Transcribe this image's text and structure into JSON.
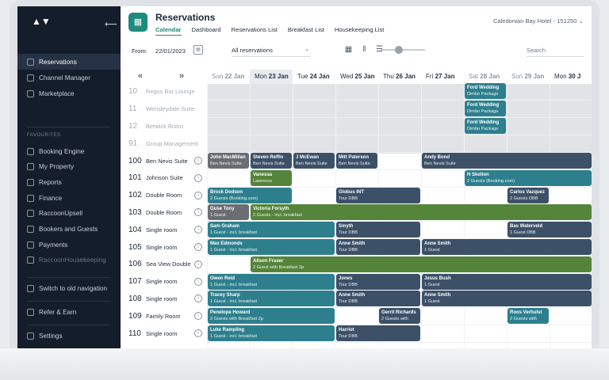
{
  "app": {
    "title": "Reservations",
    "hotel": "Caledonian Bay Hotel - 151250"
  },
  "tabs": [
    "Calendar",
    "Dashboard",
    "Reservations List",
    "Breakfast List",
    "Housekeeping List"
  ],
  "toolbar": {
    "from_label": "From:",
    "from_date": "22/01/2023",
    "filter": "All reservations",
    "search_placeholder": "Search"
  },
  "sidebar": {
    "items": [
      {
        "label": "Reservations",
        "active": true
      },
      {
        "label": "Channel Manager"
      },
      {
        "label": "Marketplace"
      }
    ],
    "favourites_label": "FAVOURITES",
    "favourites": [
      {
        "label": "Booking Engine"
      },
      {
        "label": "My Property"
      },
      {
        "label": "Reports"
      },
      {
        "label": "Finance"
      },
      {
        "label": "RaccoonUpsell"
      },
      {
        "label": "Bookers and Guests"
      },
      {
        "label": "Payments"
      },
      {
        "label": "RaccoonHousekeeping",
        "faded": true
      }
    ],
    "switch": "Switch to old navigation",
    "refer": "Refer & Earn",
    "settings": "Settings"
  },
  "dates": [
    {
      "day": "Sun",
      "num": "22 Jan",
      "weekend": true
    },
    {
      "day": "Mon",
      "num": "23 Jan",
      "today": true
    },
    {
      "day": "Tue",
      "num": "24 Jan"
    },
    {
      "day": "Wed",
      "num": "25 Jan"
    },
    {
      "day": "Thu",
      "num": "26 Jan"
    },
    {
      "day": "Fri",
      "num": "27 Jan"
    },
    {
      "day": "Sat",
      "num": "28 Jan",
      "weekend": true
    },
    {
      "day": "Sun",
      "num": "29 Jan",
      "weekend": true
    },
    {
      "day": "Mon",
      "num": "30 J"
    }
  ],
  "rooms": [
    {
      "num": "10",
      "name": "Regus Bar Lounge",
      "dim": true
    },
    {
      "num": "11",
      "name": "Wensleydale Suite",
      "dim": true
    },
    {
      "num": "12",
      "name": "Berwick Bistro",
      "dim": true
    },
    {
      "num": "91",
      "name": "Group Management",
      "dim": true
    },
    {
      "num": "100",
      "name": "Ben Nevis Suite"
    },
    {
      "num": "101",
      "name": "Johnson Suite"
    },
    {
      "num": "102",
      "name": "Double Room"
    },
    {
      "num": "103",
      "name": "Double Room"
    },
    {
      "num": "104",
      "name": "Single room"
    },
    {
      "num": "105",
      "name": "Single room"
    },
    {
      "num": "106",
      "name": "Sea View Double"
    },
    {
      "num": "107",
      "name": "Single room"
    },
    {
      "num": "108",
      "name": "Single room"
    },
    {
      "num": "109",
      "name": "Family Room"
    },
    {
      "num": "110",
      "name": "Single room"
    }
  ],
  "colors": {
    "teal": "#2e7f8e",
    "slate": "#3c5068",
    "green": "#55843b",
    "grey": "#6a6e73"
  },
  "bookings": [
    {
      "row": 0,
      "start": 6,
      "span": 1,
      "name": "Ford Wedding",
      "detail": "Dimbo Package",
      "color": "teal"
    },
    {
      "row": 1,
      "start": 6,
      "span": 1,
      "name": "Ford Wedding",
      "detail": "Dimbo Package",
      "color": "teal"
    },
    {
      "row": 2,
      "start": 6,
      "span": 1,
      "name": "Ford Wedding",
      "detail": "Dimbo Package",
      "color": "teal"
    },
    {
      "row": 4,
      "start": 0,
      "span": 1,
      "name": "John MacMillan",
      "detail": "Ben Nevis Suite",
      "color": "grey"
    },
    {
      "row": 4,
      "start": 1,
      "span": 1,
      "name": "Steven Reffin",
      "detail": "Ben Nevis Suite",
      "color": "slate"
    },
    {
      "row": 4,
      "start": 2,
      "span": 1,
      "name": "J McEwan",
      "detail": "Ben Nevis Suite",
      "color": "slate"
    },
    {
      "row": 4,
      "start": 3,
      "span": 1,
      "name": "Mitt Paterson",
      "detail": "Ben Nevis Suite",
      "color": "slate"
    },
    {
      "row": 4,
      "start": 5,
      "span": 4,
      "name": "Andy Bond",
      "detail": "Ben Nevis Suite",
      "color": "slate"
    },
    {
      "row": 5,
      "start": 1,
      "span": 1,
      "name": "Vanessa",
      "detail": "Lawrence",
      "color": "green"
    },
    {
      "row": 5,
      "start": 6,
      "span": 3,
      "name": "H Skelton",
      "detail": "2 Guests (Booking.com)",
      "color": "teal"
    },
    {
      "row": 6,
      "start": 0,
      "span": 2,
      "name": "Brock Dodson",
      "detail": "2 Guests (Booking.com)",
      "color": "teal"
    },
    {
      "row": 6,
      "start": 3,
      "span": 2,
      "name": "Globus INT",
      "detail": "Tour DBB",
      "color": "slate"
    },
    {
      "row": 6,
      "start": 7,
      "span": 1,
      "name": "Carlos Vazquez",
      "detail": "2 Guests DBB",
      "color": "slate"
    },
    {
      "row": 7,
      "start": 0,
      "span": 1,
      "name": "Guse Tony",
      "detail": "1 Guest",
      "color": "grey"
    },
    {
      "row": 7,
      "start": 1,
      "span": 8,
      "name": "Victoria Forsyth",
      "detail": "2 Guests - incl. breakfast",
      "color": "green"
    },
    {
      "row": 8,
      "start": 0,
      "span": 3,
      "name": "Sam Graham",
      "detail": "1 Guest - incl. breakfast",
      "color": "teal"
    },
    {
      "row": 8,
      "start": 3,
      "span": 2,
      "name": "Smyth",
      "detail": "Tour DBB",
      "color": "slate"
    },
    {
      "row": 8,
      "start": 7,
      "span": 2,
      "name": "Bas Waterveld",
      "detail": "1 Guest DBB",
      "color": "slate"
    },
    {
      "row": 9,
      "start": 0,
      "span": 3,
      "name": "Max Edmonds",
      "detail": "1 Guest - incl. breakfast",
      "color": "teal"
    },
    {
      "row": 9,
      "start": 3,
      "span": 2,
      "name": "Anne Smith",
      "detail": "Tour DBB",
      "color": "slate"
    },
    {
      "row": 9,
      "start": 5,
      "span": 4,
      "name": "Anne Smith",
      "detail": "1 Guest",
      "color": "slate"
    },
    {
      "row": 10,
      "start": 1,
      "span": 8,
      "name": "Alison Fraser",
      "detail": "2 Guest with Breakfast 2p",
      "color": "green"
    },
    {
      "row": 11,
      "start": 0,
      "span": 3,
      "name": "Owen Reid",
      "detail": "1 Guest - incl. breakfast",
      "color": "teal"
    },
    {
      "row": 11,
      "start": 3,
      "span": 2,
      "name": "Jones",
      "detail": "Tour DBB",
      "color": "slate"
    },
    {
      "row": 11,
      "start": 5,
      "span": 4,
      "name": "Jesus Bush",
      "detail": "1 Guest",
      "color": "slate"
    },
    {
      "row": 12,
      "start": 0,
      "span": 3,
      "name": "Tracey Sharp",
      "detail": "1 Guest - incl. breakfast",
      "color": "teal"
    },
    {
      "row": 12,
      "start": 3,
      "span": 2,
      "name": "Anne Smith",
      "detail": "Tour DBB",
      "color": "slate"
    },
    {
      "row": 12,
      "start": 5,
      "span": 4,
      "name": "Anne Smith",
      "detail": "1 Guest",
      "color": "slate"
    },
    {
      "row": 13,
      "start": 0,
      "span": 3,
      "name": "Penelope Howard",
      "detail": "2 Guests with Breakfast 2p",
      "color": "teal"
    },
    {
      "row": 13,
      "start": 4,
      "span": 1,
      "name": "Gerrit Richards",
      "detail": "2 Guests with",
      "color": "slate"
    },
    {
      "row": 13,
      "start": 7,
      "span": 1,
      "name": "Roos Verhulst",
      "detail": "2 Guests with",
      "color": "teal"
    },
    {
      "row": 14,
      "start": 0,
      "span": 3,
      "name": "Luke Rampling",
      "detail": "1 Guest - incl. breakfast",
      "color": "teal"
    },
    {
      "row": 14,
      "start": 3,
      "span": 2,
      "name": "Harriot",
      "detail": "Tour DBB",
      "color": "slate"
    }
  ]
}
